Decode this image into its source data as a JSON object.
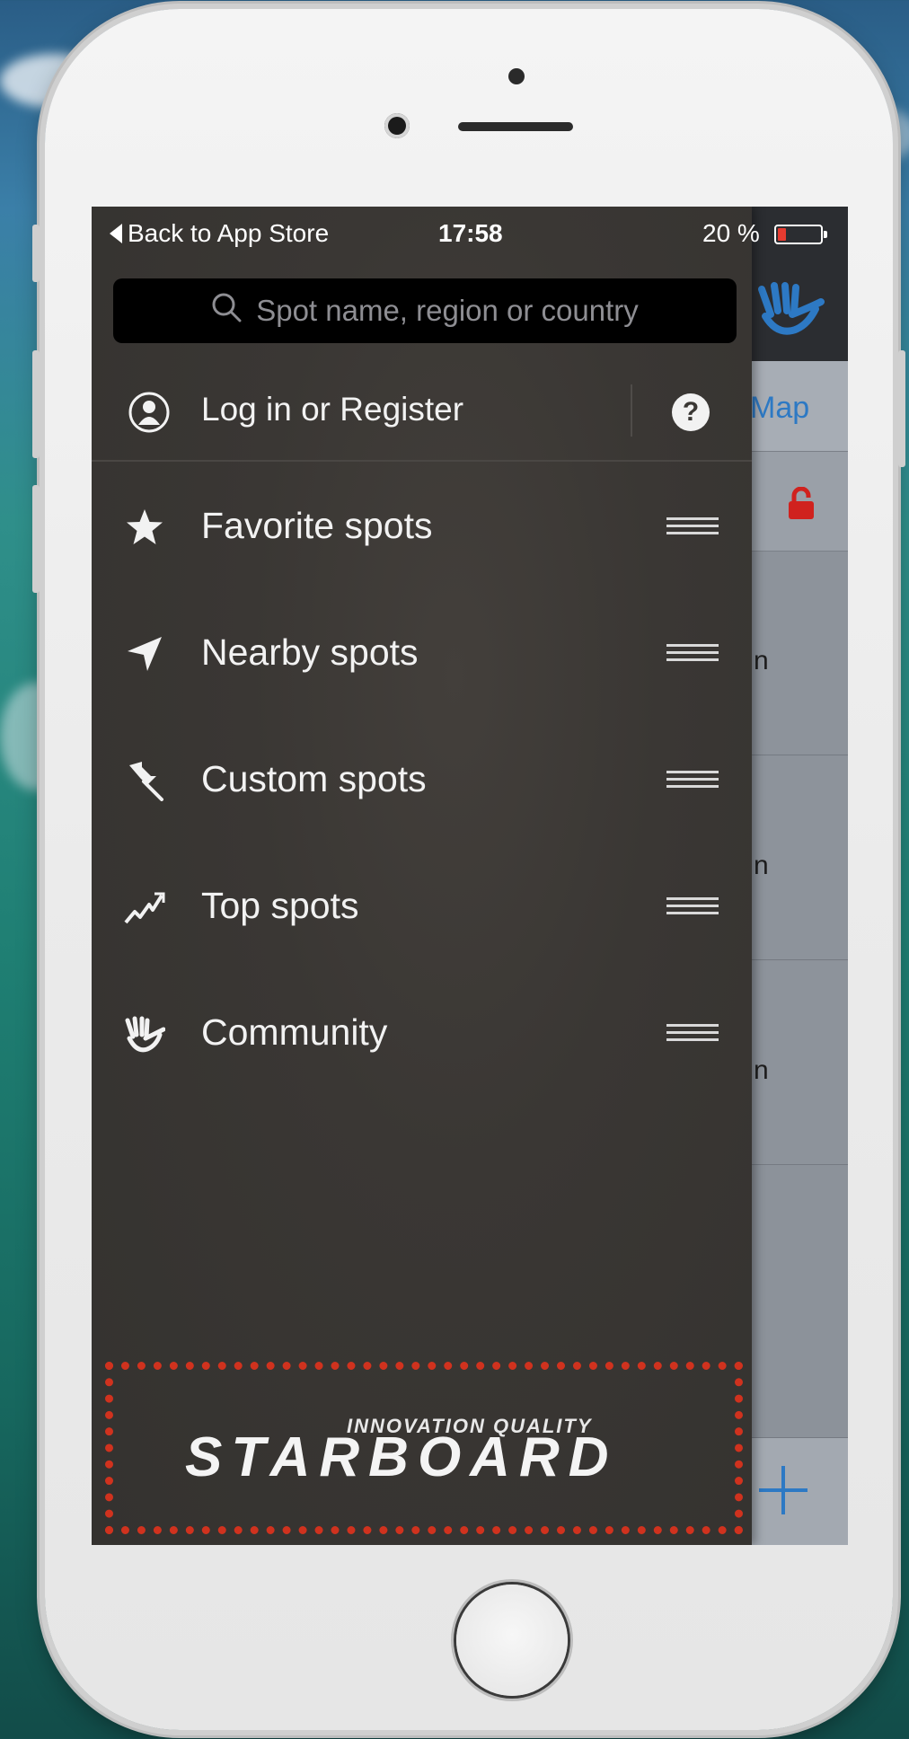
{
  "status_bar": {
    "back_label": "Back to App Store",
    "time": "17:58",
    "battery_percent": "20 %",
    "battery_level": 0.2
  },
  "search": {
    "placeholder": "Spot name, region or country"
  },
  "account": {
    "login_label": "Log in or Register",
    "help_label": "?"
  },
  "menu": [
    {
      "label": "Favorite spots",
      "icon": "star-icon"
    },
    {
      "label": "Nearby spots",
      "icon": "location-arrow-icon"
    },
    {
      "label": "Custom spots",
      "icon": "pin-icon"
    },
    {
      "label": "Top spots",
      "icon": "trend-icon"
    },
    {
      "label": "Community",
      "icon": "hang-loose-icon"
    }
  ],
  "background_app": {
    "map_link": "Map",
    "cell_text": "n"
  },
  "brand": {
    "tagline": "INNOVATION QUALITY",
    "name": "STARBOARD"
  },
  "colors": {
    "drawer": "#383532",
    "accent_blue": "#2d79c4",
    "lock_red": "#d0221e",
    "highlight_border": "#d0321e",
    "battery_low": "#e53b30"
  }
}
